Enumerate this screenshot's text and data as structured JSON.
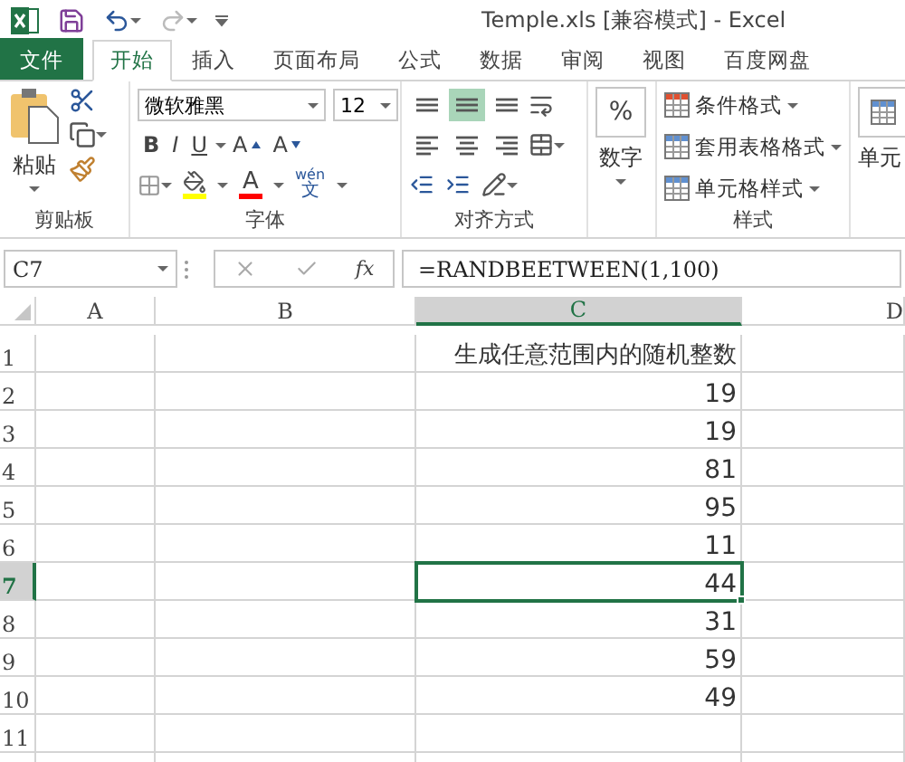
{
  "title_bar": {
    "title": "Temple.xls  [兼容模式] - Excel"
  },
  "tabs": [
    {
      "label": "文件",
      "kind": "file",
      "selected": false
    },
    {
      "label": "开始",
      "kind": "tab",
      "selected": true
    },
    {
      "label": "插入",
      "kind": "tab",
      "selected": false
    },
    {
      "label": "页面布局",
      "kind": "tab",
      "selected": false
    },
    {
      "label": "公式",
      "kind": "tab",
      "selected": false
    },
    {
      "label": "数据",
      "kind": "tab",
      "selected": false
    },
    {
      "label": "审阅",
      "kind": "tab",
      "selected": false
    },
    {
      "label": "视图",
      "kind": "tab",
      "selected": false
    },
    {
      "label": "百度网盘",
      "kind": "tab",
      "selected": false
    }
  ],
  "ribbon": {
    "clipboard": {
      "paste_label": "粘贴",
      "group_label": "剪贴板"
    },
    "font": {
      "font_name": "微软雅黑",
      "font_size": "12",
      "bold": "B",
      "italic": "I",
      "underline": "U",
      "grow": "A",
      "shrink": "A",
      "font_color": "A",
      "phonetic_top": "wén",
      "phonetic_bottom": "文",
      "group_label": "字体"
    },
    "alignment": {
      "group_label": "对齐方式",
      "buttons": [
        {
          "kind": "top",
          "selected": false
        },
        {
          "kind": "middle",
          "selected": true
        },
        {
          "kind": "bottom",
          "selected": false
        },
        {
          "kind": "left",
          "selected": false
        },
        {
          "kind": "center",
          "selected": false
        },
        {
          "kind": "right",
          "selected": false
        }
      ]
    },
    "number": {
      "symbol": "%",
      "label": "数字"
    },
    "styles": {
      "items": [
        "条件格式",
        "套用表格格式",
        "单元格样式"
      ],
      "group_label": "样式"
    },
    "cells": {
      "label": "单元"
    }
  },
  "formula_bar": {
    "name_box": "C7",
    "function_label": "fx",
    "formula": "=RANDBEETWEEN(1,100)"
  },
  "sheet": {
    "columns": [
      {
        "label": "A",
        "selected": false
      },
      {
        "label": "B",
        "selected": false
      },
      {
        "label": "C",
        "selected": true
      },
      {
        "label": "D",
        "selected": false
      }
    ],
    "rows": [
      {
        "label": "1",
        "selected": false,
        "value": "生成任意范围内的随机整数"
      },
      {
        "label": "2",
        "selected": false,
        "value": "19"
      },
      {
        "label": "3",
        "selected": false,
        "value": "19"
      },
      {
        "label": "4",
        "selected": false,
        "value": "81"
      },
      {
        "label": "5",
        "selected": false,
        "value": "95"
      },
      {
        "label": "6",
        "selected": false,
        "value": "11"
      },
      {
        "label": "7",
        "selected": true,
        "value": "44"
      },
      {
        "label": "8",
        "selected": false,
        "value": "31"
      },
      {
        "label": "9",
        "selected": false,
        "value": "59"
      },
      {
        "label": "10",
        "selected": false,
        "value": "49"
      },
      {
        "label": "11",
        "selected": false
      }
    ]
  }
}
